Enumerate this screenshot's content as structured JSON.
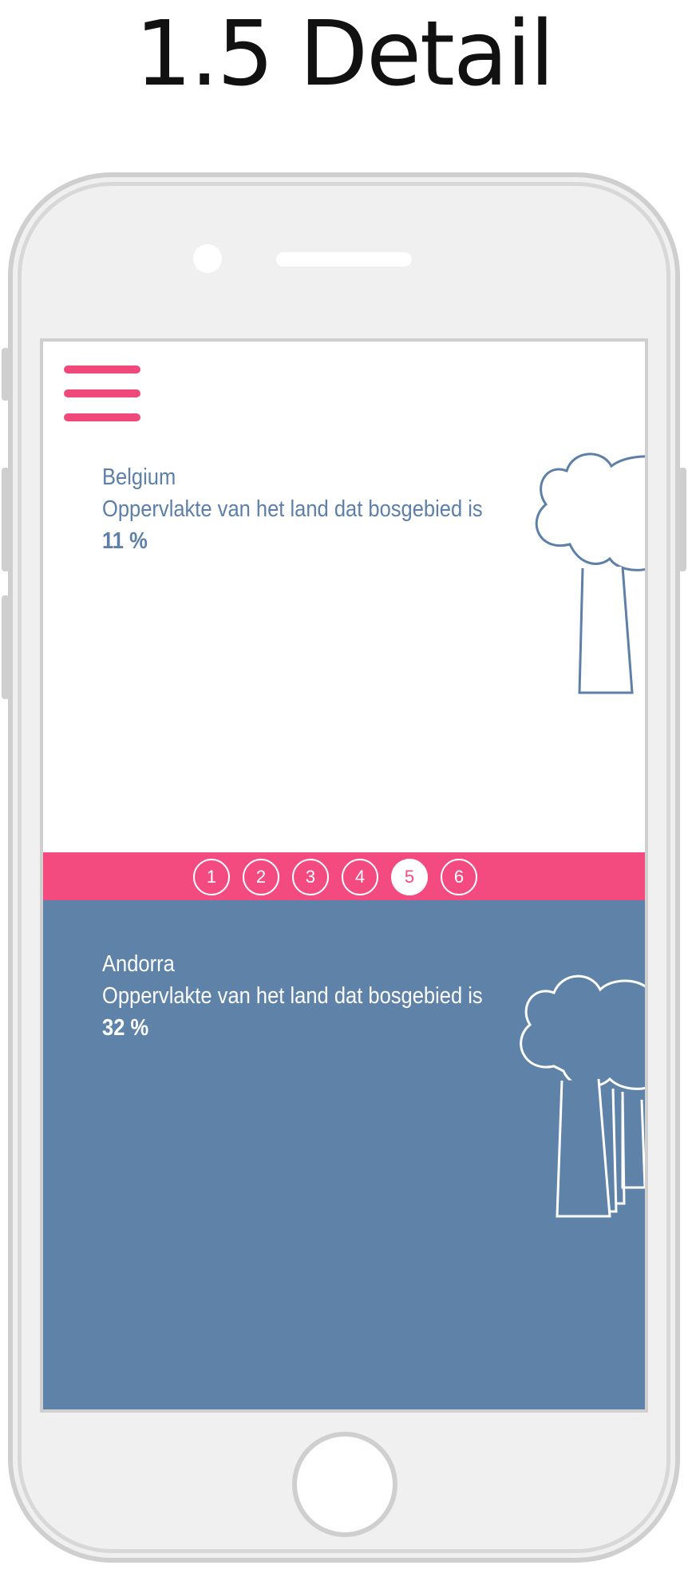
{
  "page_title": "1.5 Detail",
  "colors": {
    "accent_pink": "#f34b7f",
    "panel_blue": "#5e82a8",
    "text_blue": "#5d7fa8"
  },
  "icons": {
    "menu": "hamburger-menu-icon",
    "top_illustration": "tree-icon",
    "bottom_illustration": "forest-icon"
  },
  "top_card": {
    "country": "Belgium",
    "description": "Oppervlakte van het land dat bosgebied is",
    "value": "11 %"
  },
  "pager": {
    "pages": [
      "1",
      "2",
      "3",
      "4",
      "5",
      "6"
    ],
    "active_page": "5"
  },
  "bottom_card": {
    "country": "Andorra",
    "description": "Oppervlakte van het land dat bosgebied is",
    "value": "32 %"
  }
}
